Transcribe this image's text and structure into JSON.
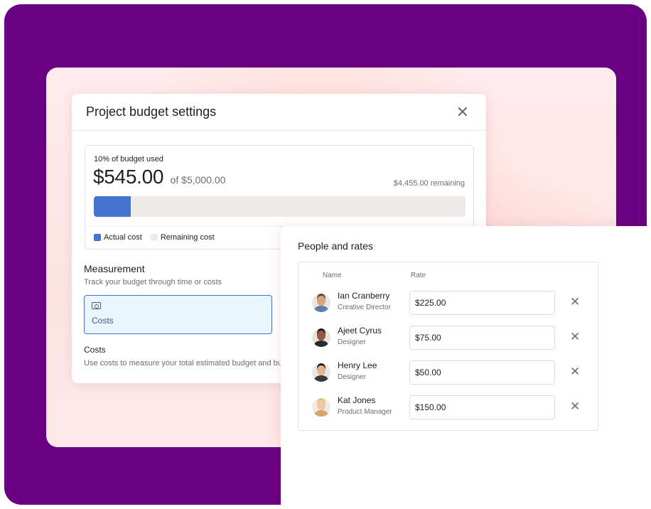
{
  "colors": {
    "frame": "#690082",
    "accent_blue": "#4573d2",
    "remaining_gray": "#edeaea",
    "selected_bg": "#e9f6fd"
  },
  "dialog": {
    "title": "Project budget settings",
    "close_icon": "close-icon",
    "budget": {
      "used_label": "10% of budget used",
      "amount": "$545.00",
      "of_total": "of $5,000.00",
      "remaining": "$4,455.00 remaining",
      "progress_fraction": 0.1,
      "legend": {
        "actual": "Actual cost",
        "remaining": "Remaining cost"
      }
    },
    "measurement": {
      "title": "Measurement",
      "subtitle": "Track your budget through time or costs",
      "option_icon": "money-icon",
      "option_label": "Costs"
    },
    "costs": {
      "title": "Costs",
      "description": "Use costs to measure your total estimated budget and budg"
    }
  },
  "rates": {
    "title": "People and rates",
    "columns": {
      "name": "Name",
      "rate": "Rate"
    },
    "people": [
      {
        "name": "Ian Cranberry",
        "role": "Creative Director",
        "rate": "$225.00",
        "skin": "#d9a27e",
        "hair": "#6b3e23",
        "shirt": "#5b7fa6",
        "bg": "#ebe4df"
      },
      {
        "name": "Ajeet Cyrus",
        "role": "Designer",
        "rate": "$75.00",
        "skin": "#8d5b3e",
        "hair": "#1c1512",
        "shirt": "#2a2a2a",
        "bg": "#e7e2dd"
      },
      {
        "name": "Henry Lee",
        "role": "Designer",
        "rate": "$50.00",
        "skin": "#e1b592",
        "hair": "#1d1a18",
        "shirt": "#3a3a3a",
        "bg": "#e9e6e3"
      },
      {
        "name": "Kat Jones",
        "role": "Product Manager",
        "rate": "$150.00",
        "skin": "#f0c7a4",
        "hair": "#e6c27a",
        "shirt": "#d8a46a",
        "bg": "#f1ebe4"
      }
    ]
  }
}
